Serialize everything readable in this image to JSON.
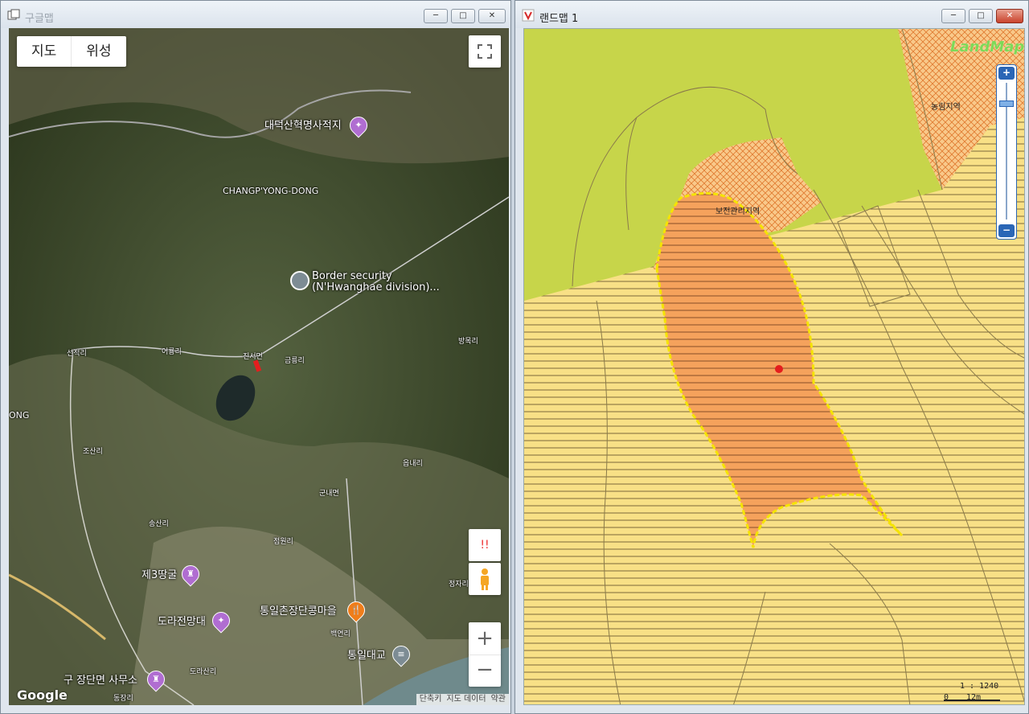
{
  "left_window": {
    "title": "구글맵",
    "controls": {
      "minimize": "─",
      "maximize": "□",
      "close": "✕"
    },
    "map_type": {
      "map_label": "지도",
      "satellite_label": "위성"
    },
    "place_labels": {
      "daedeoksan": "대덕산혁명사적지",
      "changpyong": "CHANGP'YONG-DONG",
      "border1": "Border security",
      "border2": "(N'Hwanghae division)...",
      "jinseo": "진서면",
      "eoryong": "어룡리",
      "geumreung": "금릉리",
      "seonjeok": "선적리",
      "bangmok": "방목리",
      "ong": "ONG",
      "josan": "조산리",
      "eumnae": "읍내리",
      "gunnae": "군내면",
      "songsan": "송산리",
      "jeomwon": "점원리",
      "jeongja": "정자리",
      "third_tunnel": "제3땅굴",
      "dora_obs": "도라전망대",
      "tongil_village": "통일촌장단콩마을",
      "baekyeon": "백연리",
      "tongil_bridge": "통일대교",
      "dorasan": "도라산리",
      "old_office": "구 장단면 사무소",
      "dongjang": "동장리"
    },
    "attribution": {
      "shortcut": "단축키",
      "map_data": "지도 데이터",
      "terms": "약관"
    },
    "google_logo": "Google",
    "warning_label": "!!"
  },
  "right_window": {
    "title": "랜드맵 1",
    "controls": {
      "minimize": "─",
      "maximize": "□",
      "close": "✕"
    },
    "logo": "LandMap",
    "zone_labels": {
      "agri_forest": "농림지역",
      "conservation": "보전관리지역"
    },
    "scale": {
      "ratio": "1 : 1240",
      "zero": "0",
      "distance": "12m"
    },
    "zoom": {
      "in": "+",
      "out": "−"
    }
  }
}
